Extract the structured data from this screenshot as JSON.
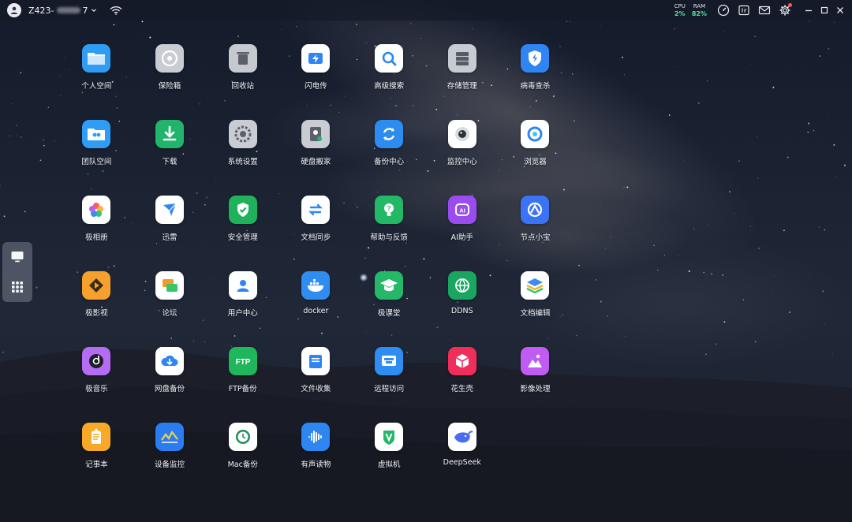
{
  "topbar": {
    "device_name_prefix": "Z423-",
    "device_name_suffix": "7",
    "cpu_label": "CPU",
    "cpu_value": "2%",
    "ram_label": "RAM",
    "ram_value": "82%",
    "icons": [
      "user-icon",
      "wifi-icon",
      "speedometer-icon",
      "task-icon",
      "mail-icon",
      "gear-icon"
    ]
  },
  "dock": {
    "items": [
      "monitor-icon",
      "app-grid-icon"
    ]
  },
  "apps": [
    {
      "label": "个人空间",
      "icon": "folder-icon",
      "color": "#2f9df4"
    },
    {
      "label": "保险箱",
      "icon": "safe-icon",
      "color": "#c9ccd3"
    },
    {
      "label": "回收站",
      "icon": "trash-icon",
      "color": "#c5c9d0"
    },
    {
      "label": "闪电传",
      "icon": "lightning-transfer-icon",
      "color": "#ffffff"
    },
    {
      "label": "高级搜索",
      "icon": "search-icon",
      "color": "#ffffff"
    },
    {
      "label": "存储管理",
      "icon": "storage-icon",
      "color": "#c7cbd2"
    },
    {
      "label": "病毒查杀",
      "icon": "shield-icon",
      "color": "#2f86f2"
    },
    {
      "label": "团队空间",
      "icon": "team-folder-icon",
      "color": "#2f9df4"
    },
    {
      "label": "下载",
      "icon": "download-icon",
      "color": "#23b46c"
    },
    {
      "label": "系统设置",
      "icon": "settings-gear-icon",
      "color": "#c9ccd3"
    },
    {
      "label": "硬盘搬家",
      "icon": "disk-move-icon",
      "color": "#c9ccd3"
    },
    {
      "label": "备份中心",
      "icon": "backup-icon",
      "color": "#2d8cf0"
    },
    {
      "label": "监控中心",
      "icon": "camera-icon",
      "color": "#ffffff"
    },
    {
      "label": "浏览器",
      "icon": "browser-icon",
      "color": "#ffffff"
    },
    {
      "label": "极相册",
      "icon": "photos-icon",
      "color": "#ffffff"
    },
    {
      "label": "迅雷",
      "icon": "thunder-icon",
      "color": "#ffffff"
    },
    {
      "label": "安全管理",
      "icon": "security-icon",
      "color": "#1fb25a"
    },
    {
      "label": "文档同步",
      "icon": "sync-icon",
      "color": "#ffffff"
    },
    {
      "label": "帮助与反馈",
      "icon": "help-bulb-icon",
      "color": "#22b866"
    },
    {
      "label": "AI助手",
      "icon": "ai-assistant-icon",
      "color": "#9a4cf0"
    },
    {
      "label": "节点小宝",
      "icon": "node-icon",
      "color": "#3a73f5"
    },
    {
      "label": "极影视",
      "icon": "video-icon",
      "color": "#f6a12e"
    },
    {
      "label": "论坛",
      "icon": "forum-icon",
      "color": "#ffffff"
    },
    {
      "label": "用户中心",
      "icon": "user-center-icon",
      "color": "#ffffff"
    },
    {
      "label": "docker",
      "icon": "docker-icon",
      "color": "#2f8df2"
    },
    {
      "label": "极课堂",
      "icon": "classroom-icon",
      "color": "#24b868"
    },
    {
      "label": "DDNS",
      "icon": "ddns-icon",
      "color": "#1aa660"
    },
    {
      "label": "文档编辑",
      "icon": "document-edit-icon",
      "color": "#ffffff"
    },
    {
      "label": "极音乐",
      "icon": "music-icon",
      "color": "#b46cf4"
    },
    {
      "label": "网盘备份",
      "icon": "cloud-backup-icon",
      "color": "#ffffff"
    },
    {
      "label": "FTP备份",
      "icon": "ftp-icon",
      "color": "#1fb65c",
      "text": "FTP"
    },
    {
      "label": "文件收集",
      "icon": "file-collect-icon",
      "color": "#ffffff"
    },
    {
      "label": "远程访问",
      "icon": "remote-access-icon",
      "color": "#2f8df2"
    },
    {
      "label": "花生壳",
      "icon": "peanut-shell-icon",
      "color": "#f02e5b"
    },
    {
      "label": "影像处理",
      "icon": "image-process-icon",
      "color": "#c05cf2"
    },
    {
      "label": "记事本",
      "icon": "notebook-icon",
      "color": "#f8a928"
    },
    {
      "label": "设备监控",
      "icon": "device-monitor-icon",
      "color": "#2a7cf0"
    },
    {
      "label": "Mac备份",
      "icon": "mac-backup-icon",
      "color": "#ffffff"
    },
    {
      "label": "有声读物",
      "icon": "audiobook-icon",
      "color": "#2d86f2"
    },
    {
      "label": "虚拟机",
      "icon": "virtual-machine-icon",
      "color": "#ffffff"
    },
    {
      "label": "DeepSeek",
      "icon": "deepseek-icon",
      "color": "#ffffff"
    }
  ]
}
